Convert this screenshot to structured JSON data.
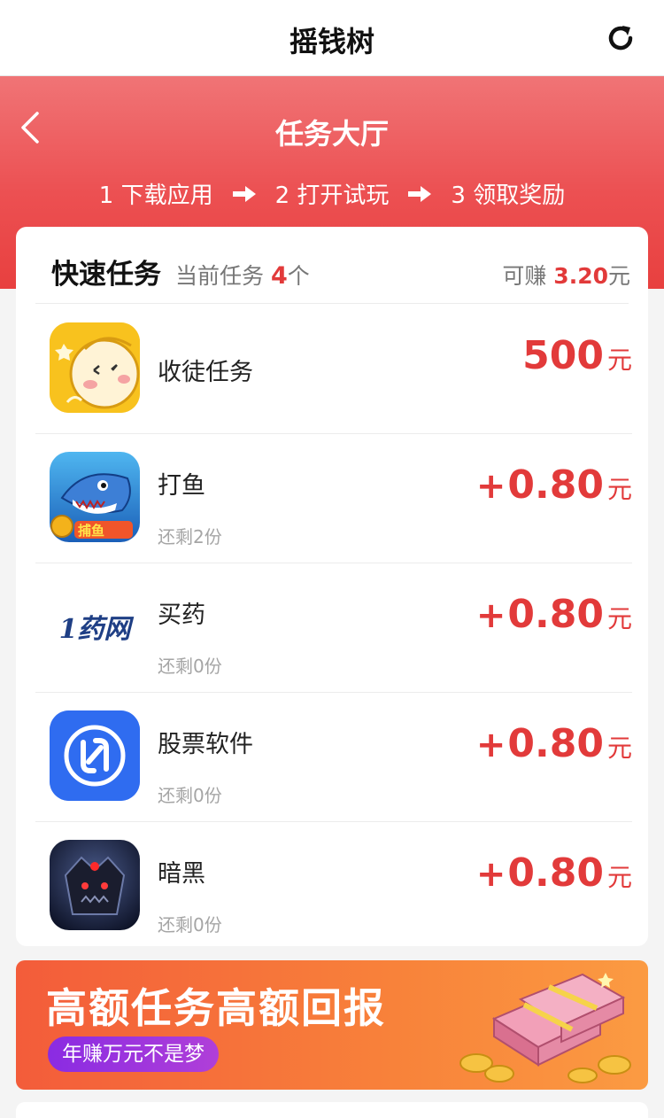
{
  "topbar": {
    "title": "摇钱树"
  },
  "header": {
    "title": "任务大厅",
    "steps": [
      "1 下载应用",
      "2 打开试玩",
      "3 领取奖励"
    ]
  },
  "card": {
    "title": "快速任务",
    "current_label": "当前任务",
    "current_count": "4",
    "current_unit": "个",
    "earn_label": "可赚",
    "earn_amount": "3.20",
    "earn_unit": "元"
  },
  "tasks": [
    {
      "name": "收徒任务",
      "reward_prefix": "",
      "reward": "500",
      "unit": "元",
      "remain": "",
      "icon": "cartoon-face-icon"
    },
    {
      "name": "打鱼",
      "reward_prefix": "+",
      "reward": "0.80",
      "unit": "元",
      "remain": "还剩2份",
      "icon": "shark-game-icon"
    },
    {
      "name": "买药",
      "reward_prefix": "+",
      "reward": "0.80",
      "unit": "元",
      "remain": "还剩0份",
      "icon": "pharmacy-logo-icon"
    },
    {
      "name": "股票软件",
      "reward_prefix": "+",
      "reward": "0.80",
      "unit": "元",
      "remain": "还剩0份",
      "icon": "stock-app-icon"
    },
    {
      "name": "暗黑",
      "reward_prefix": "+",
      "reward": "0.80",
      "unit": "元",
      "remain": "还剩0份",
      "icon": "dark-game-icon"
    }
  ],
  "icon_text": {
    "pharmacy_logo": "1药网",
    "fish_logo": "捕鱼"
  },
  "banner": {
    "headline": "高额任务高额回报",
    "tag": "年赚万元不是梦"
  },
  "colors": {
    "accent": "#e23a3a",
    "header_red": "#ec5052",
    "banner_orange": "#f8823a"
  }
}
